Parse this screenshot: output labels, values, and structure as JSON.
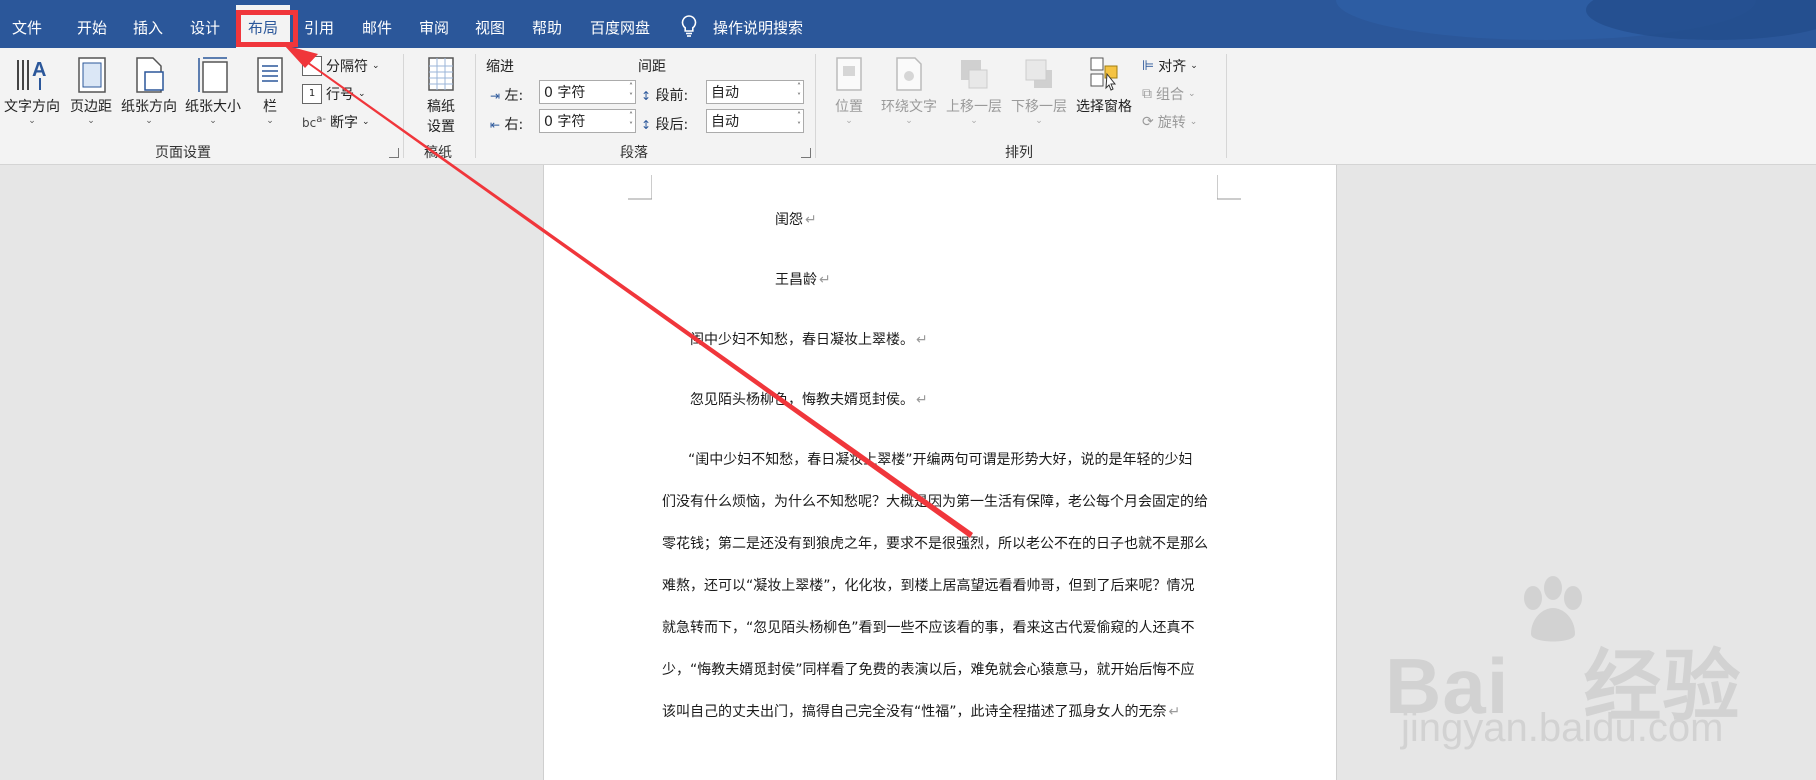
{
  "tabs": [
    {
      "label": "文件"
    },
    {
      "label": "开始"
    },
    {
      "label": "插入"
    },
    {
      "label": "设计"
    },
    {
      "label": "布局"
    },
    {
      "label": "引用"
    },
    {
      "label": "邮件"
    },
    {
      "label": "审阅"
    },
    {
      "label": "视图"
    },
    {
      "label": "帮助"
    },
    {
      "label": "百度网盘"
    },
    {
      "label": "操作说明搜索"
    }
  ],
  "active_tab": "布局",
  "ribbon": {
    "page_setup": {
      "text_direction": "文字方向",
      "margins": "页边距",
      "orientation": "纸张方向",
      "size": "纸张大小",
      "columns": "栏",
      "breaks": "分隔符",
      "line_numbers": "行号",
      "hyphenation": "断字",
      "group_label": "页面设置"
    },
    "manuscript": {
      "button_line1": "稿纸",
      "button_line2": "设置",
      "group_label": "稿纸"
    },
    "paragraph": {
      "indent_header": "缩进",
      "spacing_header": "间距",
      "left_label": "左:",
      "right_label": "右:",
      "left_value": "0 字符",
      "right_value": "0 字符",
      "before_label": "段前:",
      "after_label": "段后:",
      "before_value": "自动",
      "after_value": "自动",
      "group_label": "段落"
    },
    "arrange": {
      "position": "位置",
      "wrap_text": "环绕文字",
      "bring_forward": "上移一层",
      "send_backward": "下移一层",
      "selection_pane": "选择窗格",
      "align": "对齐",
      "group": "组合",
      "rotate": "旋转",
      "group_label": "排列"
    }
  },
  "document": {
    "title": "闺怨",
    "author": "王昌龄",
    "verse1": "闺中少妇不知愁，春日凝妆上翠楼。",
    "verse2": "忽见陌头杨柳色，悔教夫婿觅封侯。",
    "body_lines": [
      "“闺中少妇不知愁，春日凝妆上翠楼”开编两句可谓是形势大好，说的是年轻的少妇",
      "们没有什么烦恼，为什么不知愁呢？大概是因为第一生活有保障，老公每个月会固定的给",
      "零花钱；第二是还没有到狼虎之年，要求不是很强烈，所以老公不在的日子也就不是那么",
      "难熬，还可以“凝妆上翠楼”，化化妆，到楼上居高望远看看帅哥，但到了后来呢？情况",
      "就急转而下，“忽见陌头杨柳色”看到一些不应该看的事，看来这古代爱偷窥的人还真不",
      "少，“悔教夫婿觅封侯”同样看了免费的表演以后，难免就会心猿意马，就开始后悔不应",
      "该叫自己的丈夫出门，搞得自己完全没有“性福”，此诗全程描述了孤身女人的无奈"
    ],
    "return_mark": "↵"
  },
  "watermark": {
    "brand_prefix": "Bai",
    "brand_suffix": "经验",
    "url": "jingyan.baidu.com"
  },
  "colors": {
    "title_bar": "#2b579a",
    "highlight": "#f0363b"
  }
}
